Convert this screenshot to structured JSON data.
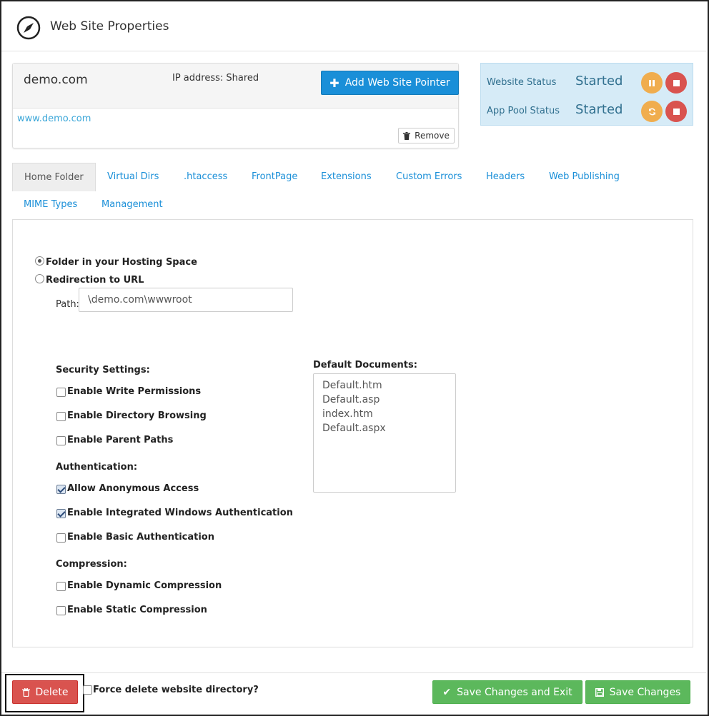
{
  "window": {
    "title": "Web Site Properties",
    "icon": "compass-icon"
  },
  "domain": {
    "name": "demo.com",
    "ip_label": "IP address: Shared",
    "add_pointer_label": "Add Web Site Pointer",
    "pointer_link": "www.demo.com",
    "remove_label": "Remove"
  },
  "status": {
    "website_label": "Website Status",
    "website_value": "Started",
    "apppool_label": "App Pool Status",
    "apppool_value": "Started"
  },
  "tabs": [
    {
      "label": "Home Folder",
      "active": true
    },
    {
      "label": "Virtual Dirs"
    },
    {
      "label": ".htaccess"
    },
    {
      "label": "FrontPage"
    },
    {
      "label": "Extensions"
    },
    {
      "label": "Custom Errors"
    },
    {
      "label": "Headers"
    },
    {
      "label": "Web Publishing"
    },
    {
      "label": "MIME Types"
    },
    {
      "label": "Management"
    }
  ],
  "home": {
    "radio_folder": "Folder in your Hosting Space",
    "radio_redirect": "Redirection to URL",
    "path_label": "Path:",
    "path_value": "\\demo.com\\wwwroot",
    "security_heading": "Security Settings:",
    "write_perms": "Enable Write Permissions",
    "dir_browsing": "Enable Directory Browsing",
    "parent_paths": "Enable Parent Paths",
    "auth_heading": "Authentication:",
    "anon_access": "Allow Anonymous Access",
    "integrated_auth": "Enable Integrated Windows Authentication",
    "basic_auth": "Enable Basic Authentication",
    "compression_heading": "Compression:",
    "dynamic_compression": "Enable Dynamic Compression",
    "static_compression": "Enable Static Compression",
    "default_docs_heading": "Default Documents:",
    "default_docs": [
      "Default.htm",
      "Default.asp",
      "index.htm",
      "Default.aspx"
    ]
  },
  "footer": {
    "delete_label": "Delete",
    "force_delete_label": "Force delete website directory?",
    "save_exit_label": "Save Changes and Exit",
    "save_label": "Save Changes"
  },
  "colors": {
    "primary": "#1a8fd8",
    "danger": "#d9534f",
    "warning": "#f0ad4e",
    "success": "#5cb85c",
    "status_bg": "#d6ebf7"
  }
}
